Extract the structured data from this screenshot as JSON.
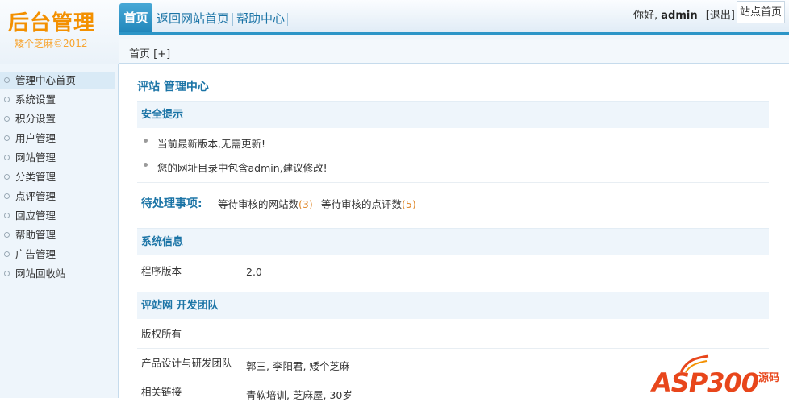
{
  "logo": {
    "title": "后台管理",
    "subtitle": "矮个芝麻©2012"
  },
  "nav": {
    "tabs": [
      "首页",
      "返回网站首页",
      "帮助中心"
    ],
    "active_index": 0
  },
  "user": {
    "greeting": "你好,",
    "name": "admin",
    "logout": "[退出]",
    "site_home": "站点首页"
  },
  "subbar": {
    "text": "首页 [+]"
  },
  "sidebar": {
    "items": [
      "管理中心首页",
      "系统设置",
      "积分设置",
      "用户管理",
      "网站管理",
      "分类管理",
      "点评管理",
      "回应管理",
      "帮助管理",
      "广告管理",
      "网站回收站"
    ],
    "active_index": 0
  },
  "main": {
    "title": "评站 管理中心",
    "security": {
      "heading": "安全提示",
      "tips": [
        "当前最新版本,无需更新!",
        "您的网址目录中包含admin,建议修改!"
      ]
    },
    "todo": {
      "label": "待处理事项:",
      "items": [
        {
          "text": "等待审核的网站数",
          "count": "(3)"
        },
        {
          "text": "等待审核的点评数",
          "count": "(5)"
        }
      ]
    },
    "sysinfo": {
      "heading": "系统信息",
      "rows": [
        {
          "key": "程序版本",
          "value": "2.0"
        }
      ]
    },
    "team": {
      "heading": "评站网 开发团队",
      "rows": [
        {
          "key": "版权所有",
          "value": ""
        },
        {
          "key": "产品设计与研发团队",
          "value": "郭三, 李阳君, 矮个芝麻"
        },
        {
          "key": "相关链接",
          "value": "青软培训, 芝麻屋, 30岁"
        }
      ]
    }
  },
  "watermark": {
    "brand": "ASP300",
    "suffix": "源码"
  },
  "colors": {
    "accent": "#2c95c7",
    "link_blue": "#1b74a6",
    "logo_orange": "#f39000",
    "count_orange": "#e08a2e"
  }
}
